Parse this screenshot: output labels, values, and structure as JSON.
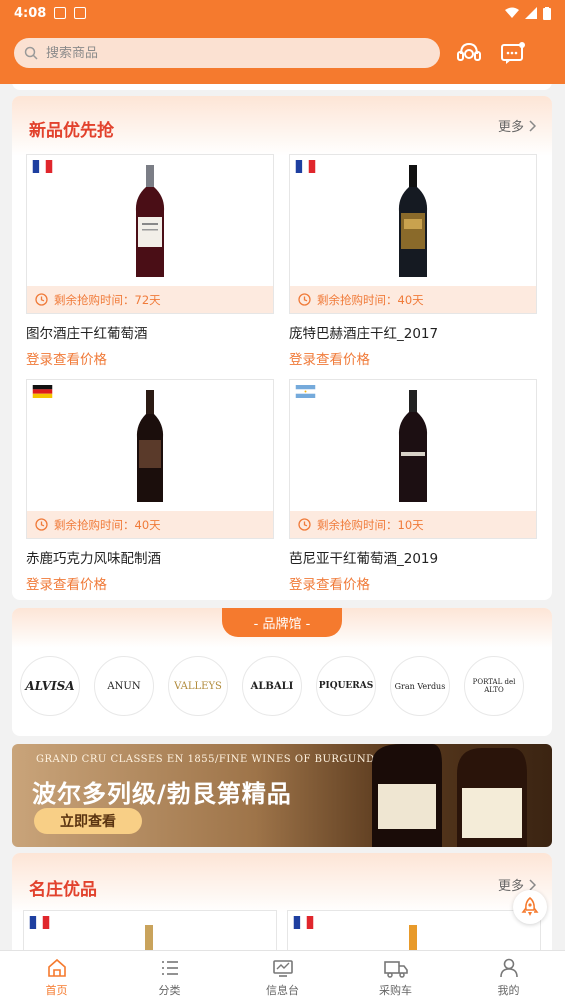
{
  "status_bar": {
    "time": "4:08"
  },
  "search": {
    "placeholder": "搜索商品"
  },
  "new_section": {
    "title": "新品优先抢",
    "more": "更多",
    "products": [
      {
        "flag": "France",
        "name": "图尔酒庄干红葡萄酒",
        "countdown": "剩余抢购时间：72天",
        "price_text": "登录查看价格"
      },
      {
        "flag": "France",
        "name": "庞特巴赫酒庄干红_2017",
        "countdown": "剩余抢购时间：40天",
        "price_text": "登录查看价格"
      },
      {
        "flag": "Germany",
        "name": "赤鹿巧克力风味配制酒",
        "countdown": "剩余抢购时间：40天",
        "price_text": "登录查看价格"
      },
      {
        "flag": "Argentina",
        "name": "芭尼亚干红葡萄酒_2019",
        "countdown": "剩余抢购时间：10天",
        "price_text": "登录查看价格"
      }
    ]
  },
  "brand_section": {
    "title": "- 品牌馆 -",
    "brands": [
      "ALVISA",
      "ANUN",
      "VALLEYS",
      "ALBALI",
      "PIQUERAS",
      "Gran Verdus",
      "PORTAL del ALTO"
    ]
  },
  "banner": {
    "top_text": "GRAND CRU CLASSES EN 1855/FINE WINES OF BURGUNDY",
    "title": "波尔多列级/勃艮第精品",
    "button": "立即查看"
  },
  "estate_section": {
    "title": "名庄优品",
    "more": "更多",
    "products": [
      {
        "flag": "France"
      },
      {
        "flag": "France"
      }
    ]
  },
  "tabbar": {
    "items": [
      "首页",
      "分类",
      "信息台",
      "采购车",
      "我的"
    ],
    "active": "首页"
  },
  "colors": {
    "accent": "#f57a2e",
    "title_red": "#e2422d",
    "price_orange": "#f07b3a"
  }
}
